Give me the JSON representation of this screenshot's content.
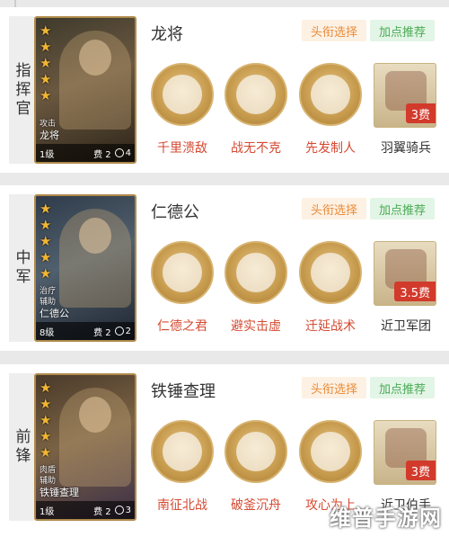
{
  "cards": [
    {
      "role": "指挥官",
      "general_name": "龙将",
      "portrait": {
        "traits": "攻击",
        "name": "龙将",
        "level": "1级",
        "cost": "费 2",
        "extra": "4",
        "stars": 5
      },
      "buttons": {
        "title": "头衔选择",
        "recommend": "加点推荐"
      },
      "skills": [
        "千里溃敌",
        "战无不克",
        "先发制人"
      ],
      "troop": {
        "name": "羽翼骑兵",
        "cost": "3费"
      }
    },
    {
      "role": "中军",
      "general_name": "仁德公",
      "portrait": {
        "traits": "治疗\n辅助",
        "name": "仁德公",
        "level": "8级",
        "cost": "费 2",
        "extra": "2",
        "stars": 5
      },
      "buttons": {
        "title": "头衔选择",
        "recommend": "加点推荐"
      },
      "skills": [
        "仁德之君",
        "避实击虚",
        "迁延战术"
      ],
      "troop": {
        "name": "近卫军团",
        "cost": "3.5费"
      }
    },
    {
      "role": "前锋",
      "general_name": "铁锤查理",
      "portrait": {
        "traits": "肉盾\n辅助",
        "name": "铁锤查理",
        "level": "1级",
        "cost": "费 2",
        "extra": "3",
        "stars": 5
      },
      "buttons": {
        "title": "头衔选择",
        "recommend": "加点推荐"
      },
      "skills": [
        "南征北战",
        "破釜沉舟",
        "攻心为上"
      ],
      "troop": {
        "name": "近卫伯手",
        "cost": "3费"
      }
    }
  ],
  "watermark": "维普手游网",
  "colors": {
    "skill_text": "#d44a32",
    "title_btn": "#e88b3a",
    "recommend_btn": "#4aaa55",
    "cost_badge": "#d23a2c"
  }
}
